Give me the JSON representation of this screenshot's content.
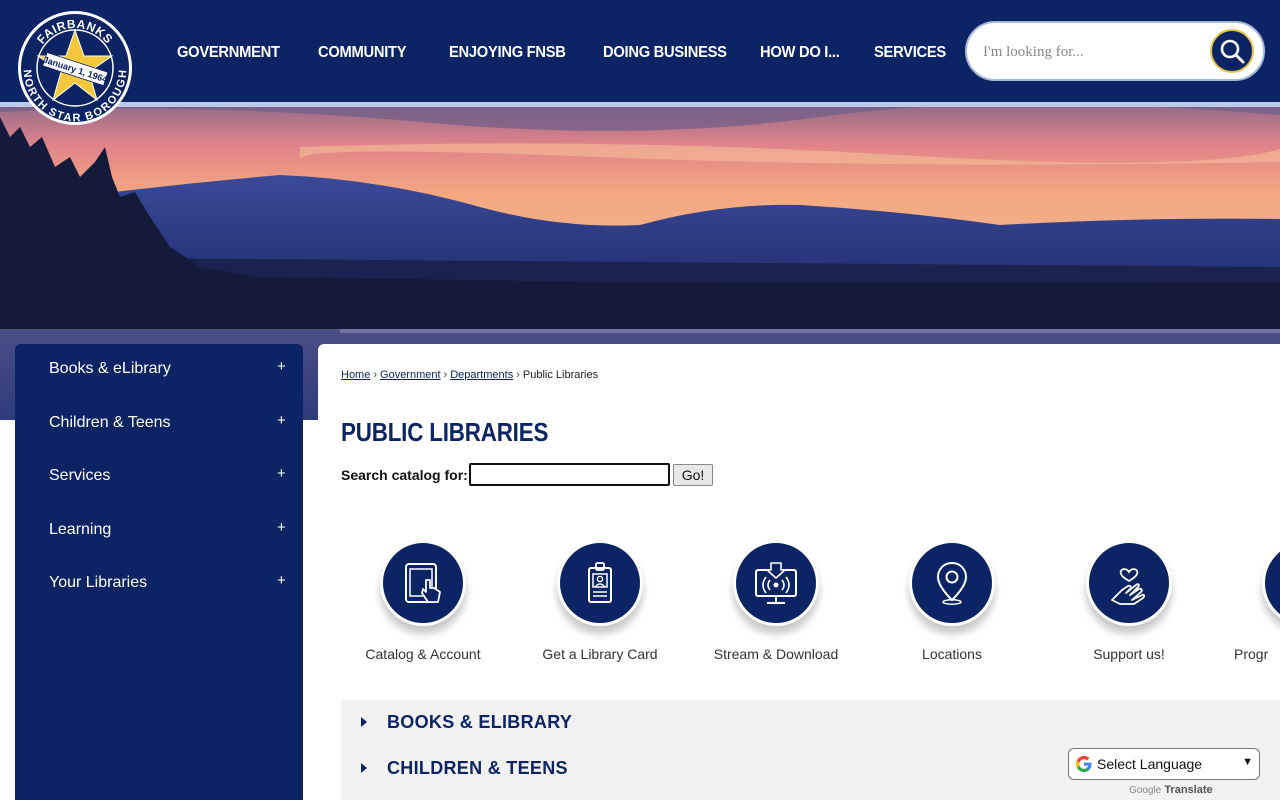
{
  "logo": {
    "arc_top": "FAIRBANKS",
    "arc_bottom": "NORTH STAR BOROUGH",
    "date": "January 1, 1964"
  },
  "nav": {
    "items": [
      {
        "label": "GOVERNMENT"
      },
      {
        "label": "COMMUNITY"
      },
      {
        "label": "ENJOYING FNSB"
      },
      {
        "label": "DOING BUSINESS"
      },
      {
        "label": "HOW DO I..."
      },
      {
        "label": "SERVICES"
      }
    ]
  },
  "search": {
    "placeholder": "I'm looking for...",
    "value": ""
  },
  "sidebar": {
    "items": [
      {
        "label": "Books & eLibrary",
        "expander": "+"
      },
      {
        "label": "Children & Teens",
        "expander": "+"
      },
      {
        "label": "Services",
        "expander": "+"
      },
      {
        "label": "Learning",
        "expander": "+"
      },
      {
        "label": "Your Libraries",
        "expander": "+"
      }
    ]
  },
  "breadcrumb": {
    "items": [
      "Home",
      "Government",
      "Departments"
    ],
    "current": "Public Libraries",
    "separator": "›"
  },
  "page": {
    "title": "PUBLIC LIBRARIES"
  },
  "catalog": {
    "label": "Search catalog for:",
    "value": "",
    "button": "Go!"
  },
  "tiles": [
    {
      "label": "Catalog & Account",
      "icon": "tablet-touch-icon"
    },
    {
      "label": "Get a Library Card",
      "icon": "id-badge-icon"
    },
    {
      "label": "Stream & Download",
      "icon": "stream-monitor-icon"
    },
    {
      "label": "Locations",
      "icon": "map-pin-icon"
    },
    {
      "label": "Support us!",
      "icon": "heart-hand-icon"
    },
    {
      "label": "Progr",
      "icon": "partial-circle"
    }
  ],
  "accordion": {
    "items": [
      {
        "label": "BOOKS & ELIBRARY"
      },
      {
        "label": "CHILDREN & TEENS"
      }
    ]
  },
  "translate": {
    "label": "Select Language",
    "powered_by": "Google",
    "powered_word": "Translate"
  },
  "colors": {
    "navy": "#0c2463",
    "gold": "#e7c24a",
    "stripe": "#b9c9e6",
    "panel_bg": "#f2f2f2"
  }
}
